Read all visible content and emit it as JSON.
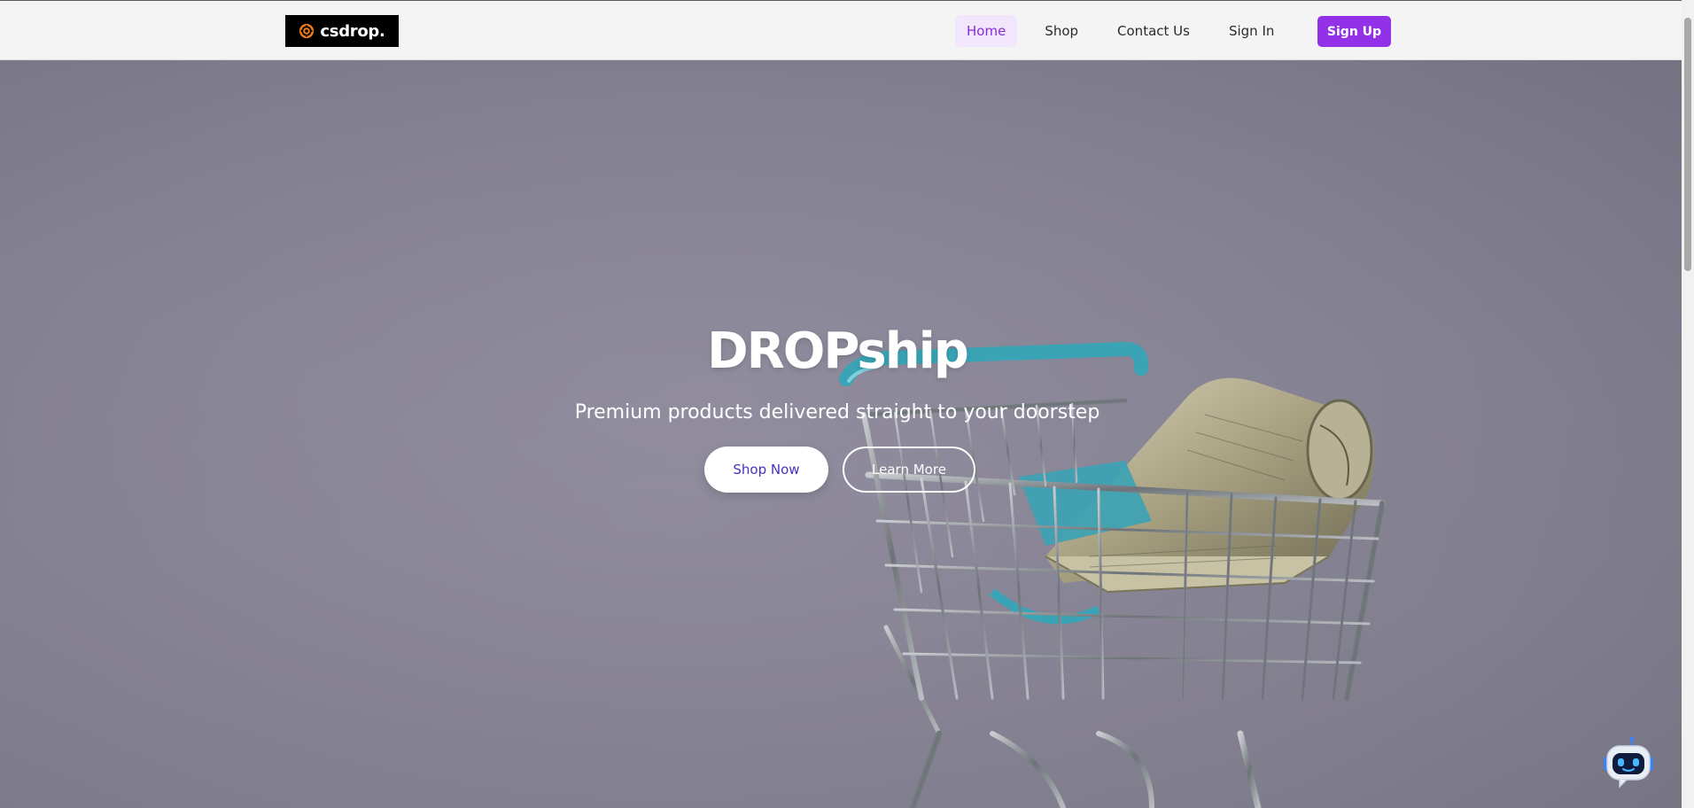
{
  "navbar": {
    "logo_text": "csdrop.",
    "links": [
      {
        "label": "Home",
        "active": true
      },
      {
        "label": "Shop",
        "active": false
      },
      {
        "label": "Contact Us",
        "active": false
      },
      {
        "label": "Sign In",
        "active": false
      }
    ],
    "signup_label": "Sign Up"
  },
  "hero": {
    "title": "DROPship",
    "subtitle": "Premium products delivered straight to your doorstep",
    "primary_button": "Shop Now",
    "secondary_button": "Learn More"
  },
  "colors": {
    "accent": "#9231e8",
    "active_link": "#8a2be2",
    "hero_background": "#8f8d9d",
    "primary_button_text": "#4a2fc2"
  },
  "icons": {
    "logo": "orange-gear-icon",
    "chat": "robot-icon"
  }
}
